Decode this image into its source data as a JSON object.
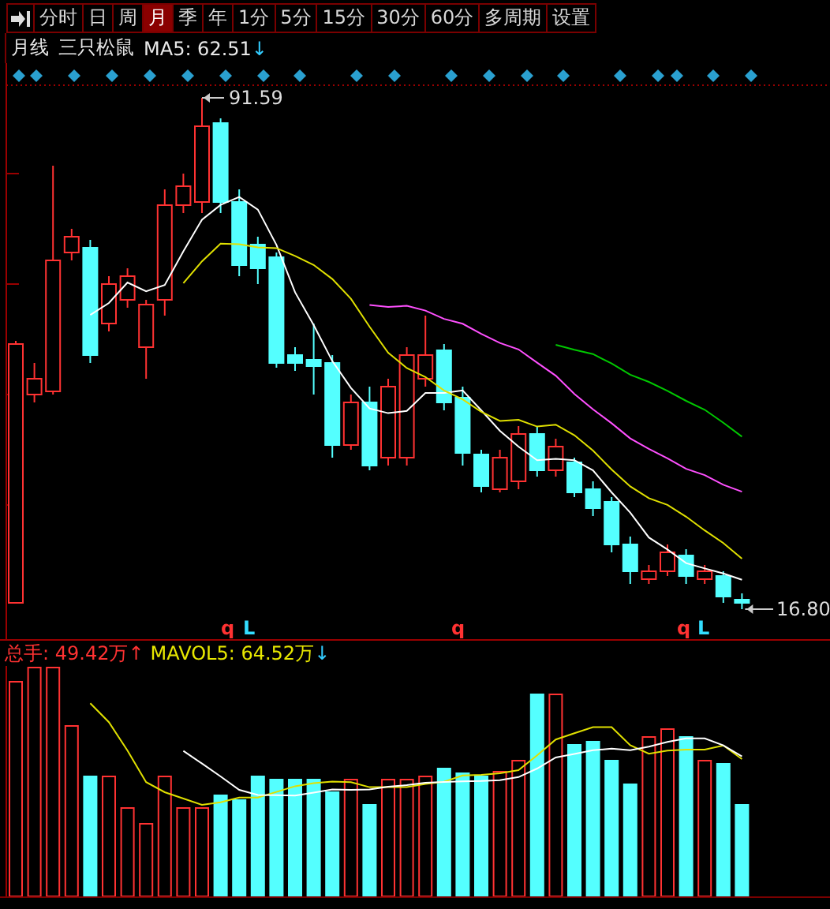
{
  "toolbar": {
    "tabs": [
      {
        "label": "分时",
        "selected": false
      },
      {
        "label": "日",
        "selected": false
      },
      {
        "label": "周",
        "selected": false
      },
      {
        "label": "月",
        "selected": true
      },
      {
        "label": "季",
        "selected": false
      },
      {
        "label": "年",
        "selected": false
      },
      {
        "label": "1分",
        "selected": false
      },
      {
        "label": "5分",
        "selected": false
      },
      {
        "label": "15分",
        "selected": false
      },
      {
        "label": "30分",
        "selected": false
      },
      {
        "label": "60分",
        "selected": false
      },
      {
        "label": "多周期",
        "selected": false
      },
      {
        "label": "设置",
        "selected": false
      }
    ]
  },
  "price_panel": {
    "period": "月线",
    "stock_name": "三只松鼠",
    "ma5": "MA5: 62.51",
    "ma5_arrow": "↓",
    "high_label": "91.59",
    "low_label": "16.80",
    "markers": [
      {
        "text": "q",
        "kind": "q"
      },
      {
        "text": "L",
        "kind": "l"
      },
      {
        "text": "q",
        "kind": "q"
      },
      {
        "text": "q",
        "kind": "q"
      },
      {
        "text": "L",
        "kind": "l"
      }
    ]
  },
  "volume_panel": {
    "total": "总手: 49.42万",
    "total_arrow": "↑",
    "mavol5": "MAVOL5: 64.52万",
    "mavol5_arrow": "↓"
  }
}
